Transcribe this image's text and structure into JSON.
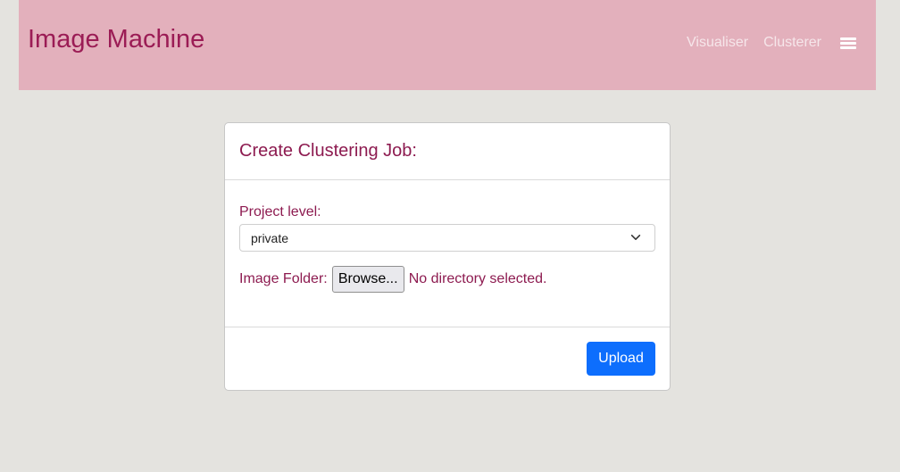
{
  "navbar": {
    "brand": "Image Machine",
    "links": [
      {
        "label": "Visualiser"
      },
      {
        "label": "Clusterer"
      }
    ],
    "menu_icon": "hamburger-menu-icon"
  },
  "card": {
    "title": "Create Clustering Job:",
    "project_level": {
      "label": "Project level:",
      "selected": "private"
    },
    "image_folder": {
      "label": "Image Folder:",
      "browse_label": "Browse...",
      "status": "No directory selected."
    },
    "upload_label": "Upload"
  },
  "colors": {
    "navbar_bg": "#e3b0bc",
    "brand": "#9b1c55",
    "label": "#8d1b50",
    "page_bg": "#e4e3df",
    "primary_button": "#0d6efd"
  }
}
